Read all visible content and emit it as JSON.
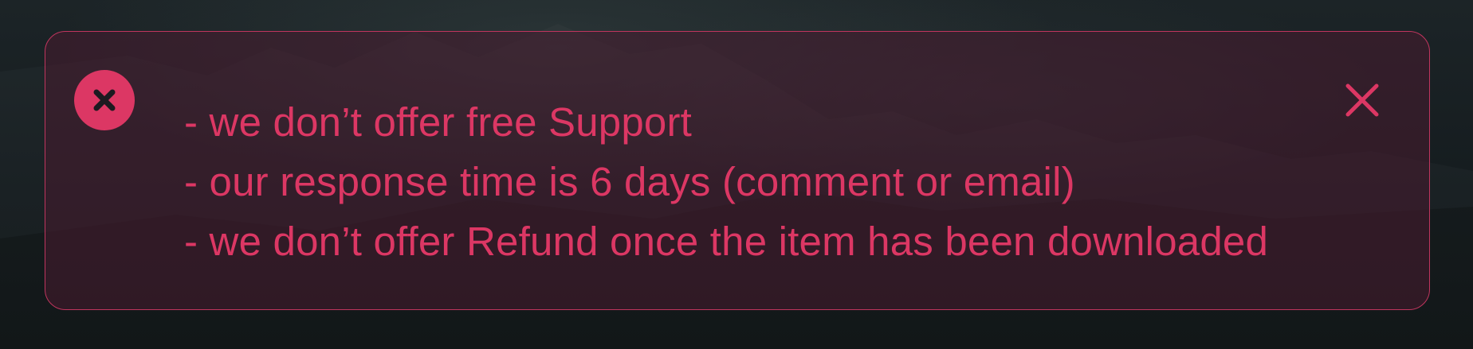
{
  "alert": {
    "status_icon": "x-circle-icon",
    "dismiss_icon": "close-icon",
    "accent_color": "#dc3764",
    "messages": [
      "- we don’t offer free Support",
      "- our response time is 6 days (comment or email)",
      "- we don’t offer Refund once the item has been downloaded"
    ]
  }
}
